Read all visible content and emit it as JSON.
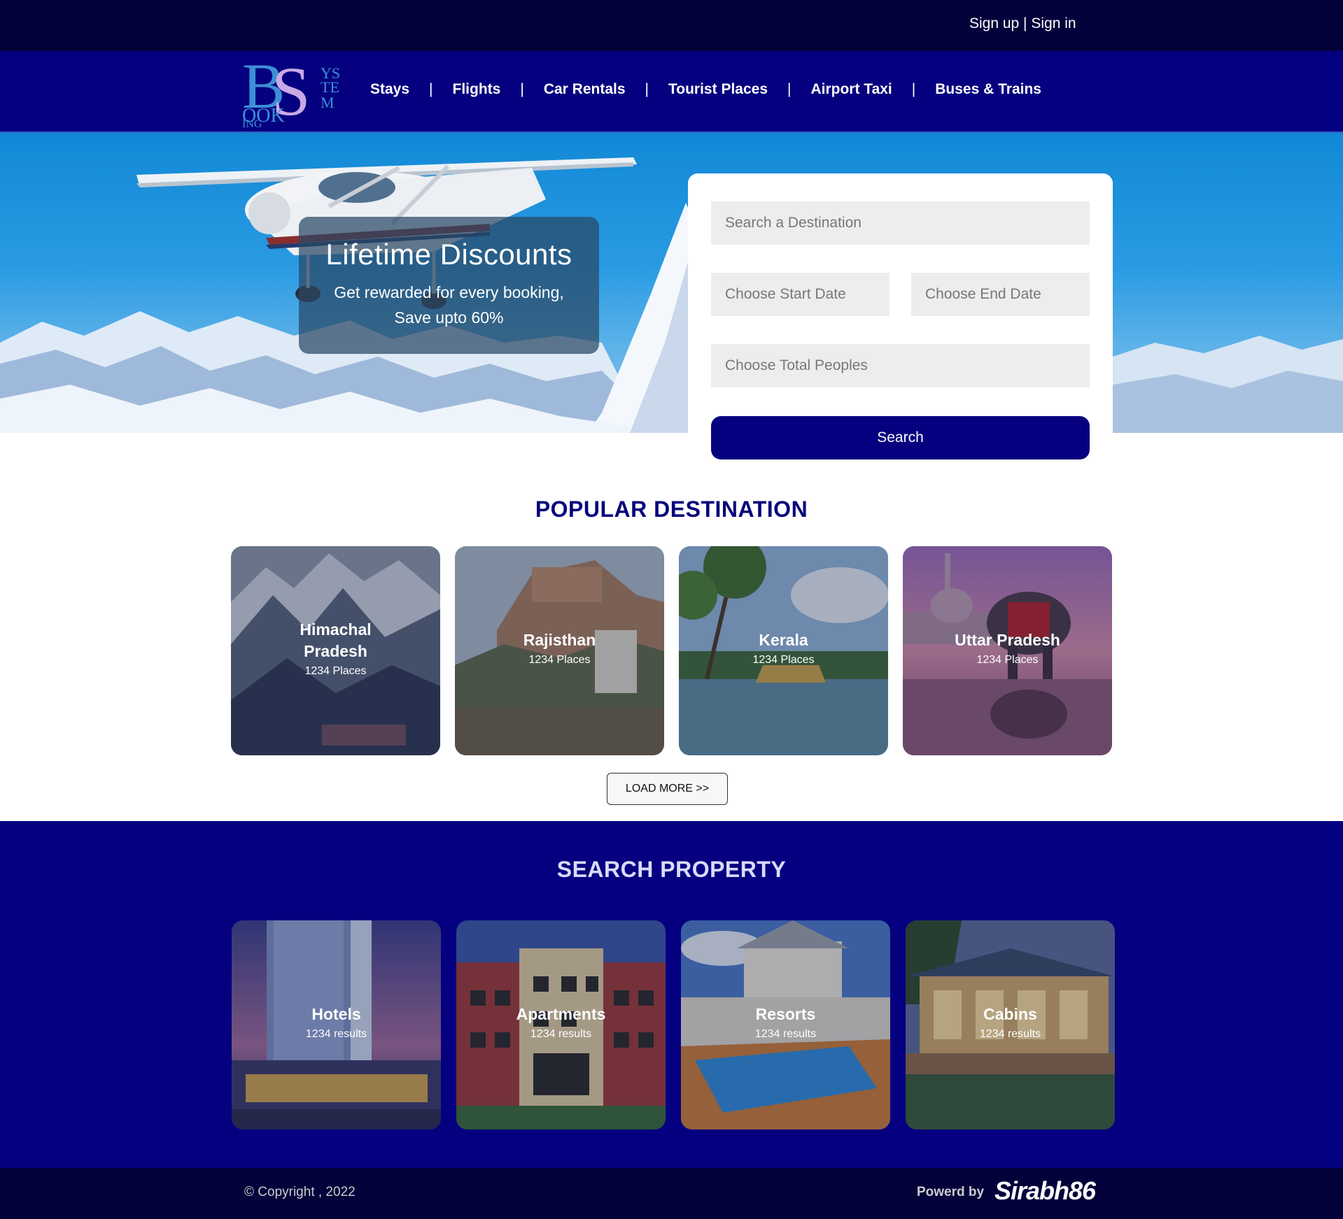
{
  "header": {
    "auth_text": "Sign up | Sign in"
  },
  "nav": {
    "items": [
      "Stays",
      "Flights",
      "Car Rentals",
      "Tourist Places",
      "Airport Taxi",
      "Buses & Trains"
    ],
    "separator": "|"
  },
  "hero": {
    "promo_title": "Lifetime Discounts",
    "promo_line1": "Get rewarded for every booking,",
    "promo_line2": "Save upto 60%"
  },
  "search": {
    "destination_placeholder": "Search a Destination",
    "start_date_placeholder": "Choose Start Date",
    "end_date_placeholder": "Choose End Date",
    "people_placeholder": "Choose Total  Peoples",
    "button": "Search"
  },
  "popular": {
    "title": "POPULAR DESTINATION",
    "items": [
      {
        "name": "Himachal Pradesh",
        "count": "1234 Places"
      },
      {
        "name": "Rajisthan",
        "count": "1234 Places"
      },
      {
        "name": "Kerala",
        "count": "1234 Places"
      },
      {
        "name": "Uttar Pradesh",
        "count": "1234 Places"
      }
    ],
    "load_more": "LOAD MORE >>"
  },
  "property": {
    "title": "SEARCH PROPERTY",
    "items": [
      {
        "name": "Hotels",
        "count": "1234 results"
      },
      {
        "name": "Apartments",
        "count": "1234 results"
      },
      {
        "name": "Resorts",
        "count": "1234 results"
      },
      {
        "name": "Cabins",
        "count": "1234 results"
      }
    ]
  },
  "footer": {
    "copyright": "© Copyright , 2022",
    "powered_by": "Powerd by",
    "brand": "Sirabh86"
  },
  "colors": {
    "top_bar": "#02013a",
    "nav_bar": "#05007f",
    "popular_title": "#07047a",
    "property_title": "#d9dcff",
    "input_bg": "#ededed"
  }
}
